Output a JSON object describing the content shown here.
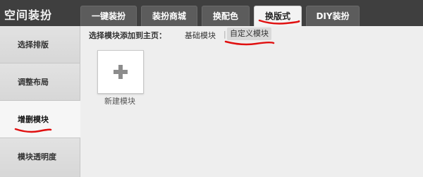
{
  "app_title": "空间装扮",
  "tabs": [
    {
      "label": "一键装扮"
    },
    {
      "label": "装扮商城"
    },
    {
      "label": "换配色"
    },
    {
      "label": "换版式"
    },
    {
      "label": "DIY装扮"
    }
  ],
  "sidebar": {
    "items": [
      {
        "label": "选择排版"
      },
      {
        "label": "调整布局"
      },
      {
        "label": "增删模块"
      },
      {
        "label": "模块透明度"
      }
    ]
  },
  "breadcrumb": {
    "prefix": "选择模块添加到主页：",
    "basic_link": "基础模块",
    "separator": "|",
    "custom_link": "自定义模块"
  },
  "module": {
    "caption": "新建模块"
  },
  "colors": {
    "topbar": "#3f3f3f",
    "annotation": "#e01010"
  }
}
